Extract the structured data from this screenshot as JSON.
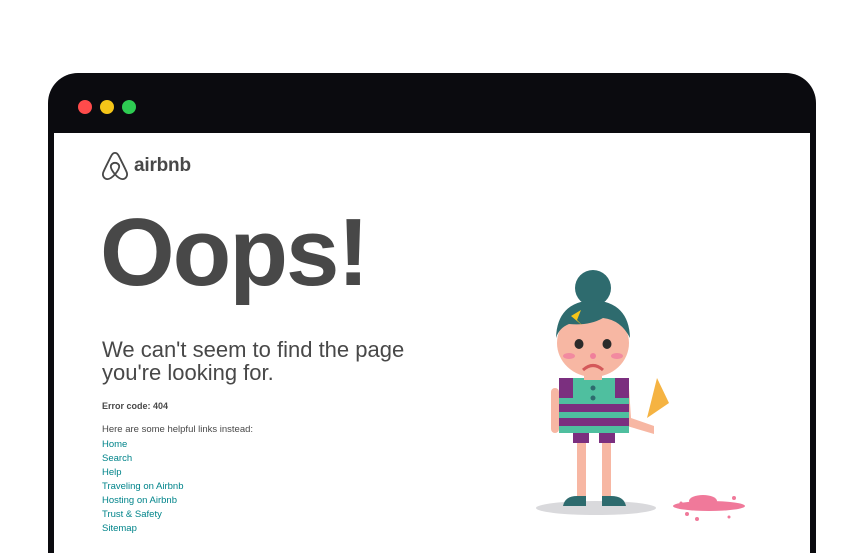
{
  "window": {
    "traffic_lights": {
      "close": "#ff4b4b",
      "minimize": "#f5c518",
      "maximize": "#2ecc52"
    }
  },
  "header": {
    "logo_text": "airbnb",
    "logo_icon": "airbnb-belo-icon"
  },
  "main": {
    "title": "Oops!",
    "subtitle": "We can't seem to find the page you're looking for.",
    "error_code": "Error code: 404",
    "helpful_intro": "Here are some helpful links instead:",
    "links": [
      {
        "label": "Home"
      },
      {
        "label": "Search"
      },
      {
        "label": "Help"
      },
      {
        "label": "Traveling on Airbnb"
      },
      {
        "label": "Hosting on Airbnb"
      },
      {
        "label": "Trust & Safety"
      },
      {
        "label": "Sitemap"
      }
    ]
  },
  "illustration": {
    "icon": "sad-girl-dropped-ice-cream-illustration"
  },
  "colors": {
    "text": "#484848",
    "link": "#00848a",
    "teal": "#2e6b6e",
    "dress_green": "#4fbf9f",
    "dress_purple": "#7b2f7f",
    "skin": "#f7b7a3",
    "cone": "#f5b342",
    "ice_cream": "#f0799a"
  }
}
